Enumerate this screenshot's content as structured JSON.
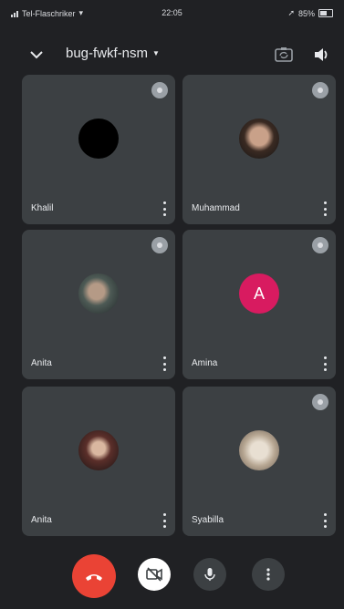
{
  "status_bar": {
    "carrier": "Tel-Flaschriker",
    "time": "22:05",
    "battery": "85%"
  },
  "header": {
    "meeting_code": "bug-fwkf-nsm",
    "dropdown_icon": "caret-down-icon",
    "back_icon": "chevron-down-icon",
    "switch_camera_icon": "switch-camera-icon",
    "speaker_icon": "speaker-icon"
  },
  "participants": [
    {
      "name": "Khalil",
      "avatar": "dark-photo"
    },
    {
      "name": "Muhammad",
      "avatar": "photo"
    },
    {
      "name": "Anita",
      "avatar": "photo"
    },
    {
      "name": "Amina",
      "avatar": "letter",
      "letter": "A",
      "color": "#d81b60"
    },
    {
      "name": "Anita",
      "avatar": "photo"
    },
    {
      "name": "Syabilla",
      "avatar": "photo"
    }
  ],
  "controls": {
    "end_call_color": "#ea4335",
    "end_call_icon": "end-call-icon",
    "camera_icon": "camera-off-icon",
    "mic_icon": "mic-icon",
    "more_icon": "more-vertical-icon"
  }
}
